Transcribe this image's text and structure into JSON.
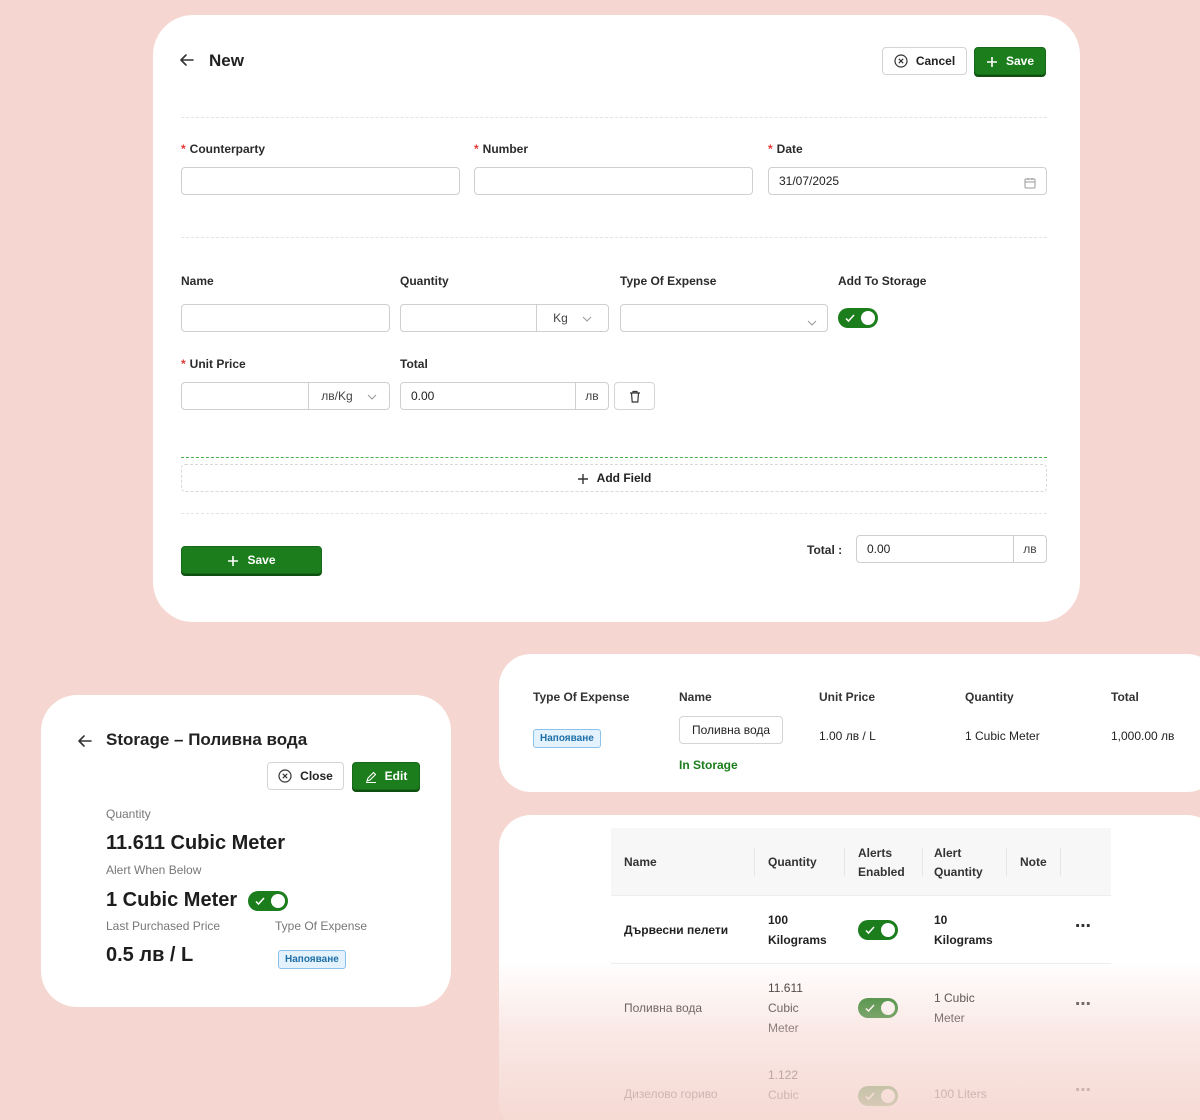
{
  "form": {
    "title": "New",
    "cancel_label": "Cancel",
    "save_label": "Save",
    "counterparty_label": "Counterparty",
    "counterparty_value": "",
    "number_label": "Number",
    "number_value": "",
    "date_label": "Date",
    "date_value": "31/07/2025",
    "name_label": "Name",
    "name_value": "",
    "quantity_label": "Quantity",
    "quantity_value": "",
    "quantity_unit": "Kg",
    "type_of_expense_label": "Type Of Expense",
    "type_of_expense_value": "",
    "add_to_storage_label": "Add To Storage",
    "add_to_storage_enabled": true,
    "unit_price_label": "Unit Price",
    "unit_price_value": "",
    "unit_price_unit": "лв/Kg",
    "total_label": "Total",
    "total_value": "0.00",
    "total_currency": "лв",
    "add_field_label": "Add Field",
    "bottom_save_label": "Save",
    "grand_total_label": "Total :",
    "grand_total_value": "0.00",
    "grand_total_currency": "лв"
  },
  "storage": {
    "title": "Storage – Поливна вода",
    "close_label": "Close",
    "edit_label": "Edit",
    "quantity_label": "Quantity",
    "quantity_value": "11.611 Cubic Meter",
    "alert_label": "Alert When Below",
    "alert_value": "1 Cubic Meter",
    "alert_enabled": true,
    "last_price_label": "Last Purchased Price",
    "last_price_value": "0.5 лв / L",
    "type_label": "Type Of Expense",
    "type_value": "Напояване"
  },
  "expense_row": {
    "headers": [
      "Type Of Expense",
      "Name",
      "Unit Price",
      "Quantity",
      "Total"
    ],
    "type": "Напояване",
    "name": "Поливна вода",
    "storage_status": "In Storage",
    "unit_price": "1.00 лв / L",
    "quantity": "1 Cubic Meter",
    "total": "1,000.00 лв"
  },
  "storage_list": {
    "headers": {
      "name": "Name",
      "quantity": "Quantity",
      "alerts_line1": "Alerts",
      "alerts_line2": "Enabled",
      "alert_qty_line1": "Alert",
      "alert_qty_line2": "Quantity",
      "note": "Note"
    },
    "rows": [
      {
        "name": "Дървесни пелети",
        "qty": [
          "100",
          "Kilograms"
        ],
        "alerts": true,
        "alert_qty": [
          "10",
          "Kilograms"
        ]
      },
      {
        "name": "Поливна вода",
        "qty": [
          "11.611",
          "Cubic",
          "Meter"
        ],
        "alerts": true,
        "alert_qty": [
          "1 Cubic",
          "Meter"
        ]
      },
      {
        "name": "Дизелово гориво",
        "qty": [
          "1.122",
          "Cubic"
        ],
        "alerts": true,
        "alert_qty": [
          "100 Liters"
        ]
      }
    ]
  },
  "colors": {
    "background": "#f5d6d0",
    "accent_green": "#1b7d1b",
    "required_red": "#e53935",
    "badge_blue": "#1e6fa8"
  }
}
